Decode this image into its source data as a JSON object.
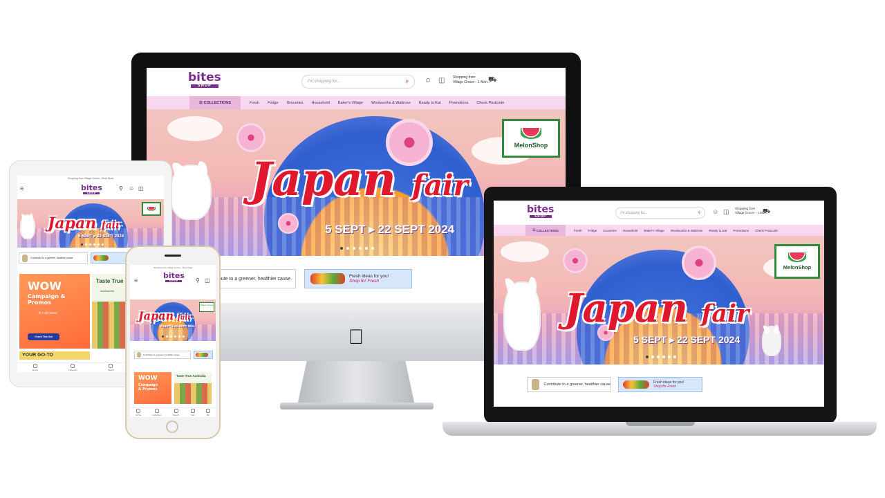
{
  "site": {
    "logo_main": "bites",
    "logo_sub": "SHOP",
    "search_placeholder": "I'm shopping for...",
    "shopping_from": "Shopping from",
    "store": "Village Grocer - 1 Mon...",
    "store_short": "Village Grocer - 1 Mon..",
    "topbar_notice": "Shopping from Village Grocer - Mont Kiara"
  },
  "nav": {
    "collections": "COLLECTIONS",
    "items": [
      "Fresh",
      "Fridge",
      "Groceries",
      "Household",
      "Baker's Village",
      "Woolworths & Waitrose",
      "Ready to Eat",
      "Promotions",
      "Check Postcode"
    ]
  },
  "banner": {
    "title_main": "Japan",
    "title_fair": "fair",
    "dates": "5 SEPT ▸ 22 SEPT 2024",
    "partner": "MelonShop",
    "partner_small": "Village Grocer",
    "slide_count": 6,
    "active_slide": 0
  },
  "promos": {
    "green": "Contribute to a greener, healthier cause",
    "green_crop": "ribute to a greener, healthier cause",
    "fresh_title": "Fresh ideas for you!",
    "fresh_sub": "Shop for Fresh"
  },
  "cards": {
    "wow": "WOW",
    "campaign": "Campaign & Promos",
    "here": "It's all here!",
    "cta": "Check This Out",
    "taste": "Taste True",
    "taste_full": "Taste True Australia",
    "woolworths": "woolworths",
    "goto": "YOUR GO-TO"
  },
  "tabs": [
    "Home",
    "Collection",
    "Search",
    "Cart",
    "Me"
  ],
  "colors": {
    "brand": "#7b2d8e",
    "nav_bg": "#f7d8ee",
    "accent": "#c2186b",
    "banner_red": "#e0182d",
    "fresh_bg": "#d6e6fb"
  },
  "icons": [
    "search-icon",
    "user-icon",
    "cart-icon",
    "delivery-truck-icon",
    "menu-icon",
    "apple-logo-icon"
  ]
}
